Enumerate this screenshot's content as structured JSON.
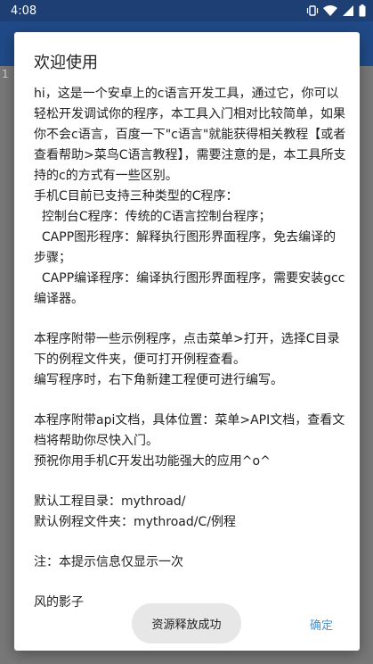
{
  "status_bar": {
    "time": "4:08",
    "icons": [
      "vibrate-icon",
      "wifi-icon",
      "signal-icon",
      "battery-icon"
    ]
  },
  "editor": {
    "line_number": "1"
  },
  "dialog": {
    "title": "欢迎使用",
    "paragraphs": [
      "hi，这是一个安卓上的c语言开发工具，通过它，你可以轻松开发调试你的程序，本工具入门相对比较简单，如果你不会c语言，百度一下\"c语言\"就能获得相关教程【或者查看帮助>菜鸟C语言教程】，需要注意的是，本工具所支持的c的方式有一些区别。\n手机C目前已支持三种类型的C程序：\n  控制台C程序：传统的C语言控制台程序；\n  CAPP图形程序：解释执行图形界面程序，免去编译的步骤；\n  CAPP编译程序：编译执行图形界面程序，需要安装gcc编译器。",
      "本程序附带一些示例程序，点击菜单>打开，选择C目录下的例程文件夹，便可打开例程查看。\n编写程序时，右下角新建工程便可进行编写。",
      "本程序附带api文档，具体位置：菜单>API文档，查看文档将帮助你尽快入门。\n预祝你用手机C开发出功能强大的应用^o^",
      "默认工程目录：mythroad/\n默认例程文件夹：mythroad/C/例程",
      "注：本提示信息仅显示一次",
      "风的影子"
    ],
    "ok_label": "确定"
  },
  "toast": {
    "message": "资源释放成功"
  },
  "colors": {
    "status_bar": "#1d3f73",
    "app_bar": "#204a87",
    "accent": "#4a90c8",
    "scrim": "#6e6e6e"
  }
}
